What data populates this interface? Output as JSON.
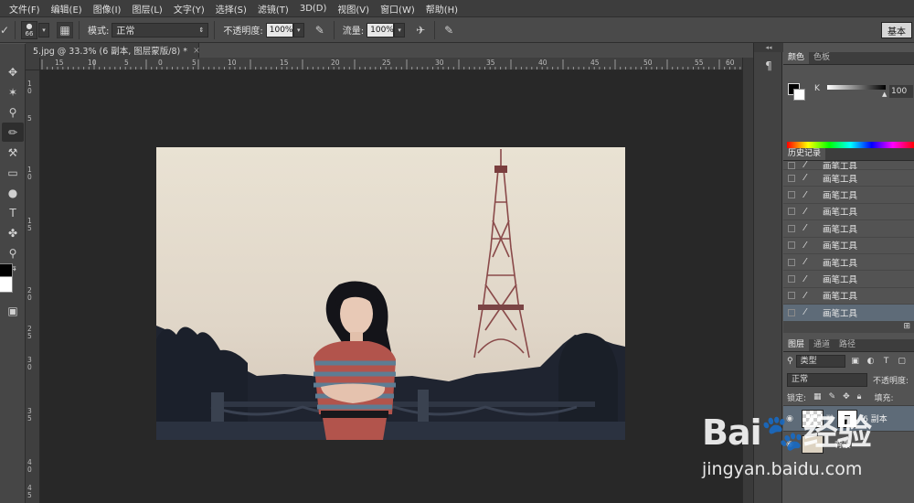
{
  "menu": [
    "文件(F)",
    "编辑(E)",
    "图像(I)",
    "图层(L)",
    "文字(Y)",
    "选择(S)",
    "滤镜(T)",
    "3D(D)",
    "视图(V)",
    "窗口(W)",
    "帮助(H)"
  ],
  "options": {
    "brush_size": "66",
    "mode_label": "模式:",
    "mode_value": "正常",
    "opacity_label": "不透明度:",
    "opacity_value": "100%",
    "flow_label": "流量:",
    "flow_value": "100%",
    "workspace_btn": "基本"
  },
  "document": {
    "tab_title": "5.jpg @ 33.3% (6 副本, 图层蒙版/8) *",
    "close": "×",
    "ruler_h": [
      "15",
      "10",
      "5",
      "0",
      "5",
      "10",
      "15",
      "20",
      "25",
      "30",
      "35",
      "40",
      "45",
      "50",
      "55",
      "60",
      "65",
      "70",
      "75",
      "80"
    ],
    "ruler_v": [
      "1",
      "0",
      "5",
      "1",
      "0",
      "1",
      "5",
      "2",
      "0",
      "2",
      "5",
      "3",
      "0",
      "3",
      "5",
      "4",
      "0",
      "4",
      "5"
    ]
  },
  "color_panel": {
    "tabs": [
      "颜色",
      "色板"
    ],
    "channel_label": "K",
    "channel_value": "100"
  },
  "history_panel": {
    "tab": "历史记录",
    "items": [
      "画笔工具",
      "画笔工具",
      "画笔工具",
      "画笔工具",
      "画笔工具",
      "画笔工具",
      "画笔工具",
      "画笔工具",
      "画笔工具",
      "画笔工具"
    ],
    "selected_index": 9
  },
  "layers_panel": {
    "tabs": [
      "图层",
      "通道",
      "路径"
    ],
    "filter_type": "类型",
    "blend_mode": "正常",
    "opacity_label": "不透明度:",
    "lock_label": "锁定:",
    "fill_label": "填充:",
    "layers": [
      {
        "name": "6 副本",
        "active": true
      },
      {
        "name": "背景",
        "active": false
      }
    ]
  },
  "watermark": {
    "line1": "Bai🐾经验",
    "line2": "jingyan.baidu.com"
  }
}
